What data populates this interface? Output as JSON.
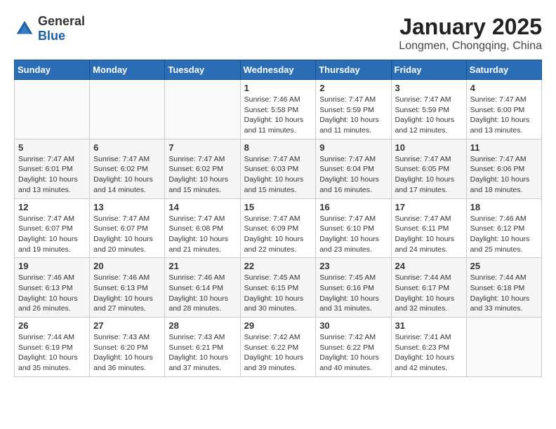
{
  "header": {
    "logo_general": "General",
    "logo_blue": "Blue",
    "month_year": "January 2025",
    "location": "Longmen, Chongqing, China"
  },
  "weekdays": [
    "Sunday",
    "Monday",
    "Tuesday",
    "Wednesday",
    "Thursday",
    "Friday",
    "Saturday"
  ],
  "weeks": [
    [
      {
        "day": "",
        "content": ""
      },
      {
        "day": "",
        "content": ""
      },
      {
        "day": "",
        "content": ""
      },
      {
        "day": "1",
        "content": "Sunrise: 7:46 AM\nSunset: 5:58 PM\nDaylight: 10 hours and 11 minutes."
      },
      {
        "day": "2",
        "content": "Sunrise: 7:47 AM\nSunset: 5:59 PM\nDaylight: 10 hours and 11 minutes."
      },
      {
        "day": "3",
        "content": "Sunrise: 7:47 AM\nSunset: 5:59 PM\nDaylight: 10 hours and 12 minutes."
      },
      {
        "day": "4",
        "content": "Sunrise: 7:47 AM\nSunset: 6:00 PM\nDaylight: 10 hours and 13 minutes."
      }
    ],
    [
      {
        "day": "5",
        "content": "Sunrise: 7:47 AM\nSunset: 6:01 PM\nDaylight: 10 hours and 13 minutes."
      },
      {
        "day": "6",
        "content": "Sunrise: 7:47 AM\nSunset: 6:02 PM\nDaylight: 10 hours and 14 minutes."
      },
      {
        "day": "7",
        "content": "Sunrise: 7:47 AM\nSunset: 6:02 PM\nDaylight: 10 hours and 15 minutes."
      },
      {
        "day": "8",
        "content": "Sunrise: 7:47 AM\nSunset: 6:03 PM\nDaylight: 10 hours and 15 minutes."
      },
      {
        "day": "9",
        "content": "Sunrise: 7:47 AM\nSunset: 6:04 PM\nDaylight: 10 hours and 16 minutes."
      },
      {
        "day": "10",
        "content": "Sunrise: 7:47 AM\nSunset: 6:05 PM\nDaylight: 10 hours and 17 minutes."
      },
      {
        "day": "11",
        "content": "Sunrise: 7:47 AM\nSunset: 6:06 PM\nDaylight: 10 hours and 18 minutes."
      }
    ],
    [
      {
        "day": "12",
        "content": "Sunrise: 7:47 AM\nSunset: 6:07 PM\nDaylight: 10 hours and 19 minutes."
      },
      {
        "day": "13",
        "content": "Sunrise: 7:47 AM\nSunset: 6:07 PM\nDaylight: 10 hours and 20 minutes."
      },
      {
        "day": "14",
        "content": "Sunrise: 7:47 AM\nSunset: 6:08 PM\nDaylight: 10 hours and 21 minutes."
      },
      {
        "day": "15",
        "content": "Sunrise: 7:47 AM\nSunset: 6:09 PM\nDaylight: 10 hours and 22 minutes."
      },
      {
        "day": "16",
        "content": "Sunrise: 7:47 AM\nSunset: 6:10 PM\nDaylight: 10 hours and 23 minutes."
      },
      {
        "day": "17",
        "content": "Sunrise: 7:47 AM\nSunset: 6:11 PM\nDaylight: 10 hours and 24 minutes."
      },
      {
        "day": "18",
        "content": "Sunrise: 7:46 AM\nSunset: 6:12 PM\nDaylight: 10 hours and 25 minutes."
      }
    ],
    [
      {
        "day": "19",
        "content": "Sunrise: 7:46 AM\nSunset: 6:13 PM\nDaylight: 10 hours and 26 minutes."
      },
      {
        "day": "20",
        "content": "Sunrise: 7:46 AM\nSunset: 6:13 PM\nDaylight: 10 hours and 27 minutes."
      },
      {
        "day": "21",
        "content": "Sunrise: 7:46 AM\nSunset: 6:14 PM\nDaylight: 10 hours and 28 minutes."
      },
      {
        "day": "22",
        "content": "Sunrise: 7:45 AM\nSunset: 6:15 PM\nDaylight: 10 hours and 30 minutes."
      },
      {
        "day": "23",
        "content": "Sunrise: 7:45 AM\nSunset: 6:16 PM\nDaylight: 10 hours and 31 minutes."
      },
      {
        "day": "24",
        "content": "Sunrise: 7:44 AM\nSunset: 6:17 PM\nDaylight: 10 hours and 32 minutes."
      },
      {
        "day": "25",
        "content": "Sunrise: 7:44 AM\nSunset: 6:18 PM\nDaylight: 10 hours and 33 minutes."
      }
    ],
    [
      {
        "day": "26",
        "content": "Sunrise: 7:44 AM\nSunset: 6:19 PM\nDaylight: 10 hours and 35 minutes."
      },
      {
        "day": "27",
        "content": "Sunrise: 7:43 AM\nSunset: 6:20 PM\nDaylight: 10 hours and 36 minutes."
      },
      {
        "day": "28",
        "content": "Sunrise: 7:43 AM\nSunset: 6:21 PM\nDaylight: 10 hours and 37 minutes."
      },
      {
        "day": "29",
        "content": "Sunrise: 7:42 AM\nSunset: 6:22 PM\nDaylight: 10 hours and 39 minutes."
      },
      {
        "day": "30",
        "content": "Sunrise: 7:42 AM\nSunset: 6:22 PM\nDaylight: 10 hours and 40 minutes."
      },
      {
        "day": "31",
        "content": "Sunrise: 7:41 AM\nSunset: 6:23 PM\nDaylight: 10 hours and 42 minutes."
      },
      {
        "day": "",
        "content": ""
      }
    ]
  ]
}
